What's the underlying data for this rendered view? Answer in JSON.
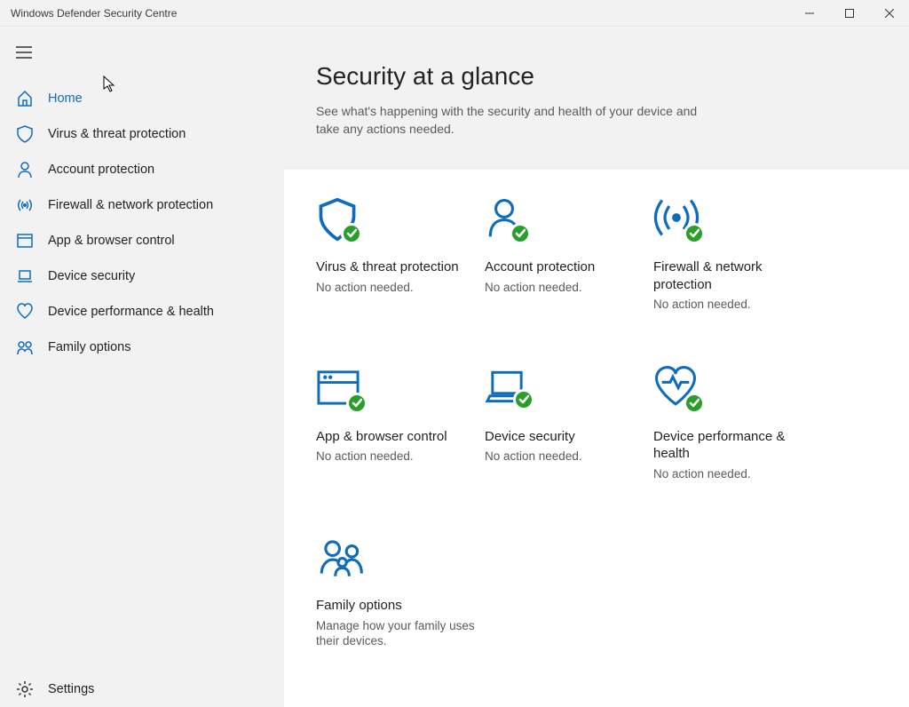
{
  "window": {
    "title": "Windows Defender Security Centre"
  },
  "sidebar": {
    "items": [
      {
        "label": "Home",
        "icon": "home-icon",
        "active": true
      },
      {
        "label": "Virus & threat protection",
        "icon": "shield-icon"
      },
      {
        "label": "Account protection",
        "icon": "person-icon"
      },
      {
        "label": "Firewall & network protection",
        "icon": "antenna-icon"
      },
      {
        "label": "App & browser control",
        "icon": "browser-icon"
      },
      {
        "label": "Device security",
        "icon": "laptop-icon"
      },
      {
        "label": "Device performance & health",
        "icon": "heart-icon"
      },
      {
        "label": "Family options",
        "icon": "family-icon"
      }
    ],
    "settings_label": "Settings"
  },
  "main": {
    "title": "Security at a glance",
    "subtitle": "See what's happening with the security and health of your device and take any actions needed.",
    "no_action": "No action needed.",
    "tiles": [
      {
        "title": "Virus & threat protection",
        "subtitle": "No action needed.",
        "icon": "shield-icon",
        "badge": true
      },
      {
        "title": "Account protection",
        "subtitle": "No action needed.",
        "icon": "person-icon",
        "badge": true
      },
      {
        "title": "Firewall & network protection",
        "subtitle": "No action needed.",
        "icon": "antenna-icon",
        "badge": true
      },
      {
        "title": "App & browser control",
        "subtitle": "No action needed.",
        "icon": "browser-icon",
        "badge": true
      },
      {
        "title": "Device security",
        "subtitle": "No action needed.",
        "icon": "laptop-icon",
        "badge": true
      },
      {
        "title": "Device performance & health",
        "subtitle": "No action needed.",
        "icon": "heart-icon",
        "badge": true
      },
      {
        "title": "Family options",
        "subtitle": "Manage how your family uses their devices.",
        "icon": "family-icon",
        "badge": false
      }
    ]
  },
  "colors": {
    "accent": "#0f6cbd",
    "ok": "#2a9e2a",
    "text": "#222",
    "muted": "#5a5a5a"
  }
}
